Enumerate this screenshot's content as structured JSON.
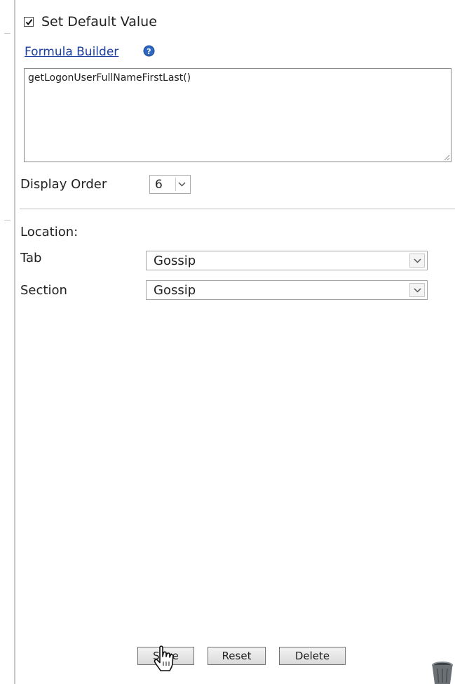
{
  "default_value": {
    "checkbox_label": "Set Default Value",
    "checked": true,
    "formula_builder_link": "Formula Builder",
    "formula_text": "getLogonUserFullNameFirstLast()"
  },
  "display_order": {
    "label": "Display Order",
    "value": "6"
  },
  "location": {
    "heading": "Location:",
    "tab_label": "Tab",
    "tab_value": "Gossip",
    "section_label": "Section",
    "section_value": "Gossip"
  },
  "buttons": {
    "save": "Save",
    "reset": "Reset",
    "delete": "Delete"
  },
  "icons": {
    "help": "question-circle-icon",
    "trash": "trash-can-icon",
    "cursor": "hand-pointer-cursor"
  },
  "colors": {
    "link": "#1a3f9e",
    "help_icon": "#1e4f9c"
  }
}
